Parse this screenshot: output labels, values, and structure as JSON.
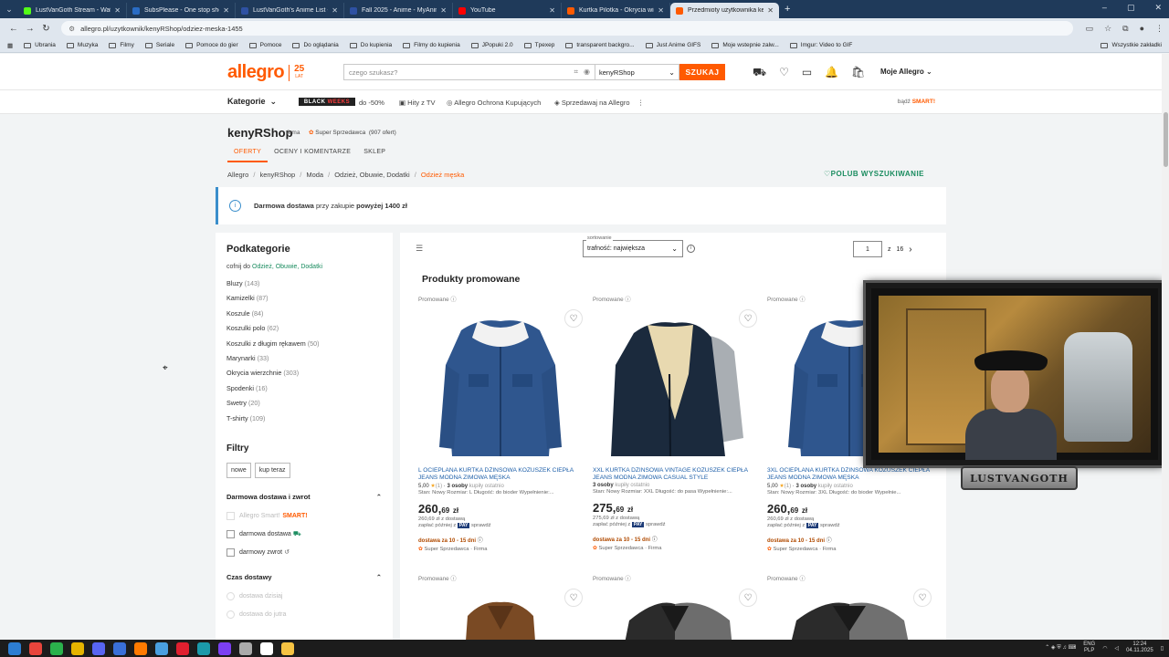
{
  "browser": {
    "tabs": [
      {
        "title": "LustVanGoth Stream - Watch Li",
        "fav_color": "#53fc18",
        "active": false
      },
      {
        "title": "SubsPlease - One stop shop fo",
        "fav_color": "#2a6cc4",
        "active": false
      },
      {
        "title": "LustVanGoth's Anime List - My",
        "fav_color": "#2e51a2",
        "active": false
      },
      {
        "title": "Fall 2025 - Anime - MyAnimeLi",
        "fav_color": "#2e51a2",
        "active": false
      },
      {
        "title": "YouTube",
        "fav_color": "#ff0000",
        "active": false
      },
      {
        "title": "Kurtka Pilotka - Okrycia wierzc",
        "fav_color": "#ff5a00",
        "active": false
      },
      {
        "title": "Przedmioty użytkownika kenyR",
        "fav_color": "#ff5a00",
        "active": true
      }
    ],
    "url": "allegro.pl/uzytkownik/kenyRShop/odziez-meska-1455",
    "bookmarks": [
      "Ubrania",
      "Muzyka",
      "Filmy",
      "Seriale",
      "Pomoce do gier",
      "Pomoce",
      "Do oglądania",
      "Do kupienia",
      "Filmy do kupienia",
      "JPopuki 2.0",
      "Tpexep",
      "transparent backgro...",
      "Just Anime GIFS",
      "Moje wstepnie zalw...",
      "Imgur: Video to GIF"
    ],
    "other_bookmarks": "Wszystkie zakładki"
  },
  "header": {
    "logo": "allegro",
    "anniversary": "25",
    "anniversary_sub": "LAT",
    "search_placeholder": "czego szukasz?",
    "scope": "kenyRShop",
    "search_button": "SZUKAJ",
    "my_allegro": "Moje Allegro"
  },
  "nav": {
    "categories": "Kategorie",
    "promo_badge_a": "BLACK",
    "promo_badge_b": "WEEKS",
    "promo_text": "do -50%",
    "links": [
      "Hity z TV",
      "Allegro Ochrona Kupujących",
      "Sprzedawaj na Allegro"
    ],
    "smart_prefix": "bądź",
    "smart": "SMART!"
  },
  "seller": {
    "name": "kenyRShop",
    "type": "firma",
    "super": "Super Sprzedawca",
    "offers": "(907 ofert)",
    "tabs": [
      "OFERTY",
      "OCENY I KOMENTARZE",
      "SKLEP"
    ]
  },
  "breadcrumb": [
    "Allegro",
    "kenyRShop",
    "Moda",
    "Odzież, Obuwie, Dodatki",
    "Odzież męska"
  ],
  "follow_search": "POLUB WYSZUKIWANIE",
  "banner": {
    "prefix": "Darmowa dostawa",
    "middle": "przy zakupie",
    "suffix": "powyżej 1400 zł"
  },
  "sidebar": {
    "title": "Podkategorie",
    "back_prefix": "cofnij do",
    "back_link": "Odzież, Obuwie, Dodatki",
    "items": [
      {
        "label": "Bluzy",
        "count": "(143)"
      },
      {
        "label": "Kamizelki",
        "count": "(87)"
      },
      {
        "label": "Koszule",
        "count": "(84)"
      },
      {
        "label": "Koszulki polo",
        "count": "(62)"
      },
      {
        "label": "Koszulki z długim rękawem",
        "count": "(50)"
      },
      {
        "label": "Marynarki",
        "count": "(33)"
      },
      {
        "label": "Okrycia wierzchnie",
        "count": "(303)"
      },
      {
        "label": "Spodenki",
        "count": "(16)"
      },
      {
        "label": "Swetry",
        "count": "(20)"
      },
      {
        "label": "T-shirty",
        "count": "(109)"
      }
    ],
    "filters_title": "Filtry",
    "chips": [
      "nowe",
      "kup teraz"
    ],
    "delivery_title": "Darmowa dostawa i zwrot",
    "delivery_options": [
      "Allegro Smart!",
      "darmowa dostawa",
      "darmowy zwrot"
    ],
    "time_title": "Czas dostawy",
    "time_options": [
      "dostawa dzisiaj",
      "dostawa do jutra"
    ]
  },
  "listing": {
    "sort_label": "sortowanie",
    "sort_value": "trafność: największa",
    "page": "1",
    "page_of": "z",
    "pages_total": "16",
    "promo_title": "Produkty promowane",
    "promoted_label": "Promowane",
    "products": [
      {
        "name": "L OCIEPLANA KURTKA DŻINSOWA KOŻUSZEK CIEPŁA JEANS MODNA ZIMOWA MĘSKA",
        "rating": "5,00",
        "rating_count": "(1)",
        "buyers": "3 osoby",
        "buyers_suffix": "kupiły ostatnio",
        "attrs": "Stan: Nowy   Rozmiar: L   Długość: do bioder   Wypełnienie:...",
        "price_main": "260,",
        "price_cents": "69",
        "currency": "zł",
        "with_delivery": "260,69 zł z dostawą",
        "pay_later": "zapłać później z",
        "pay_tag": "PAY",
        "check": "sprawdź",
        "delivery": "dostawa za 10 - 15 dni",
        "seller": "Super Sprzedawca · Firma"
      },
      {
        "name": "XXL KURTKA DŻINSOWA VINTAGE KOŻUSZEK CIEPŁA JEANS MODNA ZIMOWA CASUAL STYLE",
        "rating": "",
        "rating_count": "",
        "buyers": "3 osoby",
        "buyers_suffix": "kupiły ostatnio",
        "attrs": "Stan: Nowy   Rozmiar: XXL   Długość: do pasa   Wypełnienie:...",
        "price_main": "275,",
        "price_cents": "69",
        "currency": "zł",
        "with_delivery": "275,69 zł z dostawą",
        "pay_later": "zapłać później z",
        "pay_tag": "PAY",
        "check": "sprawdź",
        "delivery": "dostawa za 10 - 15 dni",
        "seller": "Super Sprzedawca · Firma"
      },
      {
        "name": "3XL OCIEPLANA KURTKA DŻINSOWA KOŻUSZEK CIEPŁA JEANS MODNA ZIMOWA MĘSKA",
        "rating": "5,00",
        "rating_count": "(1)",
        "buyers": "3 osoby",
        "buyers_suffix": "kupiły ostatnio",
        "attrs": "Stan: Nowy   Rozmiar: 3XL   Długość: do bioder   Wypełnie...",
        "price_main": "260,",
        "price_cents": "69",
        "currency": "zł",
        "with_delivery": "260,69 zł z dostawą",
        "pay_later": "zapłać później z",
        "pay_tag": "PAY",
        "check": "sprawdź",
        "delivery": "dostawa za 10 - 15 dni",
        "seller": "Super Sprzedawca · Firma"
      }
    ]
  },
  "overlay": {
    "streamer_tag": "LUSTVANGOTH"
  },
  "taskbar": {
    "lang": "ENG",
    "lang2": "PLP",
    "time": "12:24",
    "date": "04.11.2025"
  },
  "colors": {
    "brand": "#ff5a00",
    "link_green": "#1a8c5f",
    "tabstrip": "#1f3a5a"
  }
}
